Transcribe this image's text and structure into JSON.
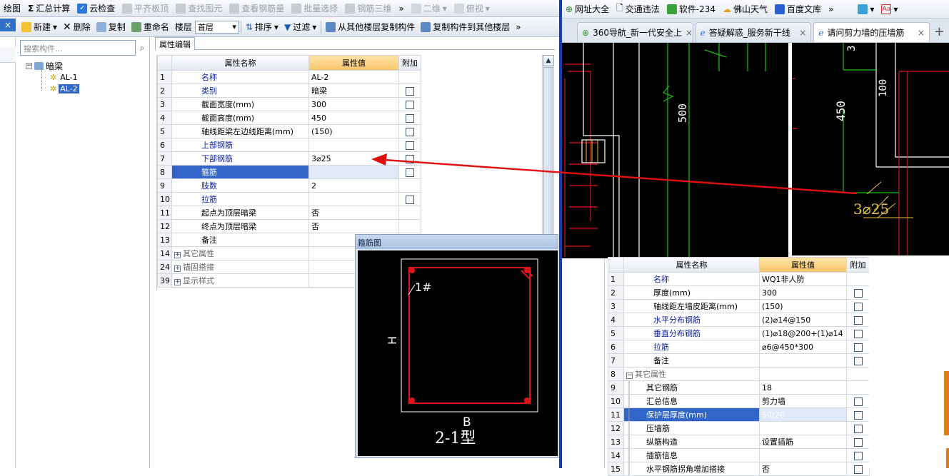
{
  "toolbar_main": {
    "items": [
      {
        "label": "绘图",
        "icon": "draw-icon",
        "enabled": true
      },
      {
        "label": "汇总计算",
        "icon": "sigma-icon",
        "enabled": true
      },
      {
        "label": "云检查",
        "icon": "cloud-check-icon",
        "enabled": true
      },
      {
        "label": "平齐板顶",
        "icon": "align-top-icon",
        "enabled": false
      },
      {
        "label": "查找图元",
        "icon": "binoculars-icon",
        "enabled": false
      },
      {
        "label": "查看钢筋量",
        "icon": "rebar-view-icon",
        "enabled": false
      },
      {
        "label": "批量选择",
        "icon": "batch-select-icon",
        "enabled": false
      },
      {
        "label": "钢筋三维",
        "icon": "rebar-3d-icon",
        "enabled": false
      }
    ],
    "view_mode": "二维",
    "view_angle": "俯视",
    "overflow": "»"
  },
  "toolbar_component": {
    "new": "新建",
    "delete": "删除",
    "copy": "复制",
    "rename": "重命名",
    "floor_label": "楼层",
    "floor_value": "首层",
    "sort": "排序",
    "filter": "过滤",
    "copy_from_other": "从其他楼层复制构件",
    "copy_to_other": "复制构件到其他楼层",
    "overflow": "»"
  },
  "left_close": "×",
  "tree": {
    "search_placeholder": "搜索构件...",
    "root": "暗梁",
    "children": [
      "AL-1",
      "AL-2"
    ],
    "selected": "AL-2"
  },
  "prop_tab": "属性编辑",
  "prop_grid": {
    "headers": [
      "属性名称",
      "属性值",
      "附加"
    ],
    "rows": [
      {
        "n": "1",
        "name": "名称",
        "value": "AL-2",
        "check": false,
        "blue": true
      },
      {
        "n": "2",
        "name": "类别",
        "value": "暗梁",
        "check": true,
        "blue": true
      },
      {
        "n": "3",
        "name": "截面宽度(mm)",
        "value": "300",
        "check": true,
        "blue": false
      },
      {
        "n": "4",
        "name": "截面高度(mm)",
        "value": "450",
        "check": true,
        "blue": false
      },
      {
        "n": "5",
        "name": "轴线距梁左边线距离(mm)",
        "value": "(150)",
        "check": true,
        "blue": false
      },
      {
        "n": "6",
        "name": "上部钢筋",
        "value": "",
        "check": true,
        "blue": true
      },
      {
        "n": "7",
        "name": "下部钢筋",
        "value": "3⌀25",
        "check": true,
        "blue": true
      },
      {
        "n": "8",
        "name": "箍筋",
        "value": "",
        "check": true,
        "blue": true,
        "selected": true
      },
      {
        "n": "9",
        "name": "肢数",
        "value": "2",
        "check": false,
        "blue": true
      },
      {
        "n": "10",
        "name": "拉筋",
        "value": "",
        "check": true,
        "blue": true
      },
      {
        "n": "11",
        "name": "起点为顶层暗梁",
        "value": "否",
        "check": false,
        "blue": false
      },
      {
        "n": "12",
        "name": "终点为顶层暗梁",
        "value": "否",
        "check": false,
        "blue": false
      },
      {
        "n": "13",
        "name": "备注",
        "value": "",
        "check": false,
        "blue": false
      },
      {
        "n": "14",
        "name": "其它属性",
        "value": "",
        "group": true
      },
      {
        "n": "24",
        "name": "锚固搭接",
        "value": "",
        "group": true
      },
      {
        "n": "39",
        "name": "显示样式",
        "value": "",
        "group": true
      }
    ]
  },
  "stirrup": {
    "title": "箍筋图",
    "label_bar": "1#",
    "label_h": "H",
    "label_b": "B",
    "type": "2-1型"
  },
  "browser": {
    "bookmarks": [
      "网址大全",
      "交通违法",
      "软件-234",
      "佛山天气",
      "百度文库"
    ],
    "bookmarks_more": "»",
    "tabs": [
      {
        "title": "360导航_新一代安全上",
        "active": false
      },
      {
        "title": "答疑解惑_服务新干线",
        "active": false
      },
      {
        "title": "请问剪力墙的压墙筋",
        "active": true
      }
    ],
    "new_tab": "+",
    "close": "×"
  },
  "cad1": {
    "dim": "500"
  },
  "cad2": {
    "dims": [
      "3",
      "100",
      "450"
    ],
    "rebar": "3⌀25"
  },
  "wall_grid": {
    "headers": [
      "属性名称",
      "属性值",
      "附加"
    ],
    "rows": [
      {
        "n": "1",
        "name": "名称",
        "value": "WQ1非人防",
        "check": false,
        "blue": true
      },
      {
        "n": "2",
        "name": "厚度(mm)",
        "value": "300",
        "check": true,
        "blue": false
      },
      {
        "n": "3",
        "name": "轴线距左墙皮距离(mm)",
        "value": "(150)",
        "check": true,
        "blue": false
      },
      {
        "n": "4",
        "name": "水平分布钢筋",
        "value": "(2)⌀14@150",
        "check": true,
        "blue": true
      },
      {
        "n": "5",
        "name": "垂直分布钢筋",
        "value": "(1)⌀18@200+(1)⌀14",
        "check": true,
        "blue": true
      },
      {
        "n": "6",
        "name": "拉筋",
        "value": "⌀6@450*300",
        "check": true,
        "blue": true
      },
      {
        "n": "7",
        "name": "备注",
        "value": "",
        "check": true,
        "blue": false
      },
      {
        "n": "8",
        "name": "其它属性",
        "value": "",
        "group": true
      },
      {
        "n": "9",
        "name": "其它钢筋",
        "value": "18",
        "check": false,
        "sub": true
      },
      {
        "n": "10",
        "name": "汇总信息",
        "value": "剪力墙",
        "check": true,
        "sub": true
      },
      {
        "n": "11",
        "name": "保护层厚度(mm)",
        "value": "50/20",
        "check": true,
        "sub": true,
        "selected": true
      },
      {
        "n": "12",
        "name": "压墙筋",
        "value": "",
        "check": true,
        "sub": true
      },
      {
        "n": "13",
        "name": "纵筋构造",
        "value": "设置插筋",
        "check": true,
        "sub": true
      },
      {
        "n": "14",
        "name": "插筋信息",
        "value": "",
        "check": true,
        "sub": true
      },
      {
        "n": "15",
        "name": "水平钢筋拐角增加搭接",
        "value": "否",
        "check": true,
        "sub": true
      }
    ]
  },
  "colors": {
    "selection": "#3166c8",
    "header_highlight": "#f6c46a",
    "cad_line": "#e0141c",
    "cad_green": "#19c219",
    "annotation_arrow": "#e01010"
  }
}
